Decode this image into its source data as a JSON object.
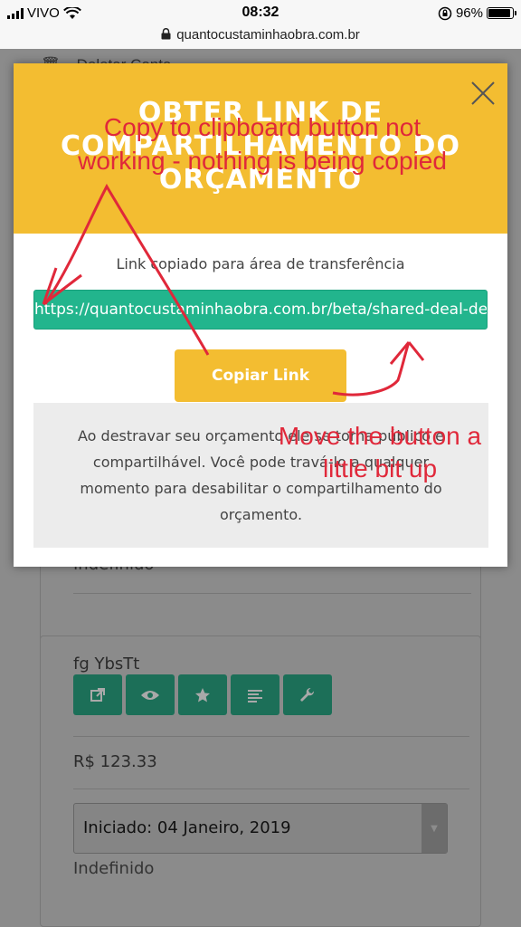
{
  "status_bar": {
    "carrier": "VIVO",
    "time": "08:32",
    "battery_percent": "96%",
    "battery_level": 0.96,
    "icons": [
      "signal-icon",
      "wifi-icon",
      "orientation-lock-icon",
      "battery-icon"
    ]
  },
  "url_bar": {
    "url": "quantocustaminhaobra.com.br",
    "icon": "lock-icon"
  },
  "background_page": {
    "menu_item": "Deletar Conta",
    "card1": {
      "status": "Indefinido"
    },
    "card2": {
      "title": "fg YbsTt",
      "action_icons": [
        "external-link-icon",
        "eye-icon",
        "star-icon",
        "list-icon",
        "wrench-icon"
      ],
      "price": "R$ 123.33",
      "select_value": "Iniciado: 04 Janeiro, 2019",
      "status": "Indefinido"
    }
  },
  "modal": {
    "title": "OBTER LINK DE COMPARTILHAMENTO DO ORÇAMENTO",
    "copied_message": "Link copiado para área de transferência",
    "link_value": "https://quantocustaminhaobra.com.br/beta/shared-deal-de",
    "copy_button": "Copiar Link",
    "info_text": "Ao destravar seu orçamento ele se torna público e compartilhável. Você pode travá-lo a qualquer momento para desabilitar o compartilhamento do orçamento.",
    "colors": {
      "header": "#f3bd31",
      "link_field": "#22b58d",
      "button": "#f3bd31"
    }
  },
  "annotations": {
    "note1": "Copy to clipboard button not working - nothing is being copied",
    "note2": "Move the button a little bit up",
    "color": "#e0283a"
  }
}
